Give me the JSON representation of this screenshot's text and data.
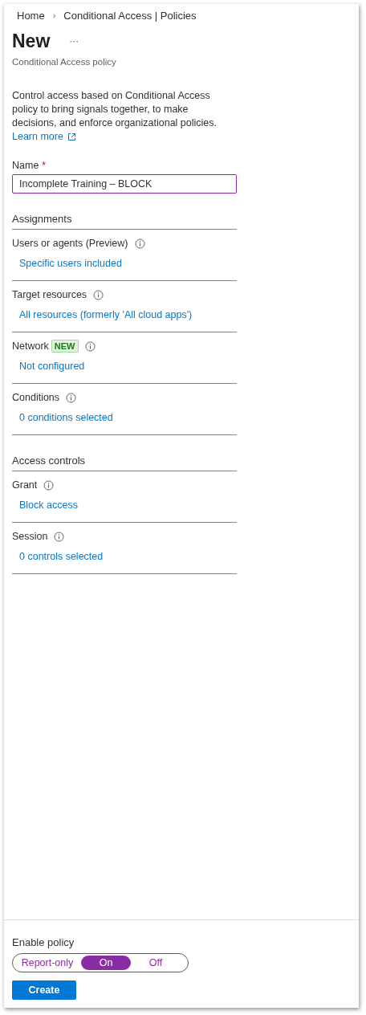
{
  "breadcrumb": [
    {
      "label": "Home"
    },
    {
      "label": "Conditional Access | Policies"
    }
  ],
  "separator": "›",
  "title": "New",
  "more": "···",
  "subtitle": "Conditional Access policy",
  "description": "Control access based on Conditional Access policy to bring signals together, to make decisions, and enforce organizational policies.",
  "learn_more": "Learn more",
  "name_field": {
    "label": "Name",
    "required_mark": "*",
    "value": "Incomplete Training – BLOCK"
  },
  "sections": [
    {
      "heading": "Assignments",
      "rows": [
        {
          "label": "Users or agents (Preview)",
          "value": "Specific users included"
        },
        {
          "label": "Target resources",
          "value": "All resources (formerly 'All cloud apps')"
        },
        {
          "label": "Network",
          "badge": "NEW",
          "value": "Not configured"
        },
        {
          "label": "Conditions",
          "value": "0 conditions selected"
        }
      ]
    },
    {
      "heading": "Access controls",
      "rows": [
        {
          "label": "Grant",
          "value": "Block access"
        },
        {
          "label": "Session",
          "value": "0 controls selected"
        }
      ]
    }
  ],
  "enable_policy": {
    "label": "Enable policy",
    "options": [
      {
        "label": "Report-only",
        "selected": false
      },
      {
        "label": "On",
        "selected": true
      },
      {
        "label": "Off",
        "selected": false
      }
    ]
  },
  "create_button": "Create"
}
